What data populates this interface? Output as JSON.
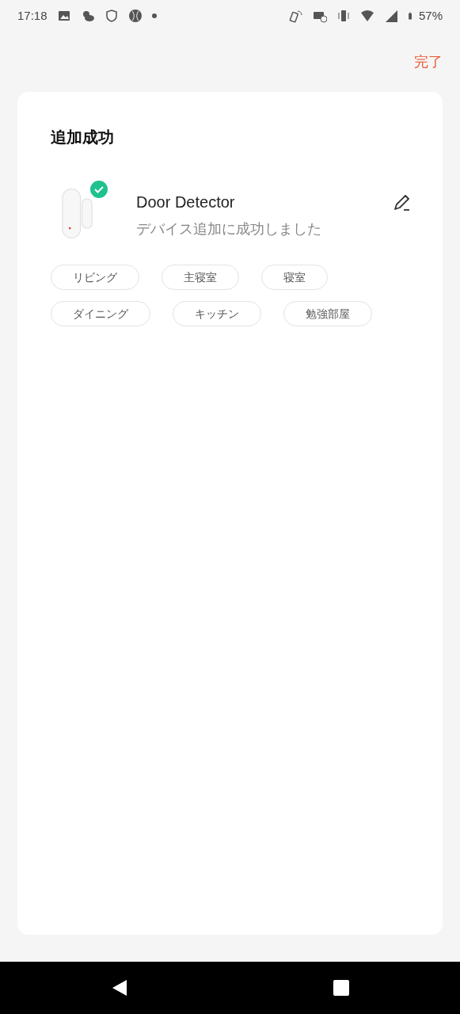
{
  "status_bar": {
    "time": "17:18",
    "battery": "57%"
  },
  "header": {
    "done": "完了"
  },
  "card": {
    "title": "追加成功",
    "device": {
      "name": "Door Detector",
      "status": "デバイス追加に成功しました",
      "added": true
    },
    "rooms": [
      {
        "label": "リビング",
        "selected": false
      },
      {
        "label": "主寝室",
        "selected": false
      },
      {
        "label": "寝室",
        "selected": false
      },
      {
        "label": "ダイニング",
        "selected": false
      },
      {
        "label": "キッチン",
        "selected": false
      },
      {
        "label": "勉強部屋",
        "selected": false
      }
    ]
  }
}
